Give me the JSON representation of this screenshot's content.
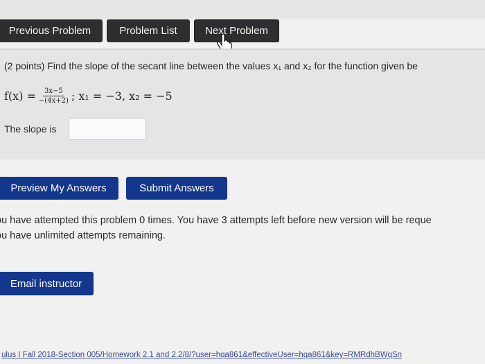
{
  "nav": {
    "previous_label": "Previous Problem",
    "list_label": "Problem List",
    "next_label": "Next Problem"
  },
  "problem": {
    "statement": "(2 points) Find the slope of the secant line between the values x₁ and x₂ for the function given be",
    "function_lhs": "f(x) =",
    "numerator": "3x−5",
    "denominator": "−(4x+2)",
    "values": "; x₁ = −3, x₂ = −5",
    "slope_label": "The slope is",
    "answer_value": ""
  },
  "actions": {
    "preview_label": "Preview My Answers",
    "submit_label": "Submit Answers"
  },
  "attempts": {
    "line1": "ou have attempted this problem 0 times. You have 3 attempts left before new version will be reque",
    "line2": "ou have unlimited attempts remaining."
  },
  "email": {
    "label": "Email instructor"
  },
  "footer": {
    "url_text": "ulus I Fall 2018-Section 005/Homework 2.1 and 2.2/8/?user=hqa861&effectiveUser=hqa861&key=RMRdhBWqSn"
  },
  "colors": {
    "nav_button": "#2e2e30",
    "action_button": "#13378c",
    "panel": "#e4e5e7",
    "page": "#f1f1ef"
  },
  "icons": {
    "cursor": "hand-pointer-icon"
  }
}
